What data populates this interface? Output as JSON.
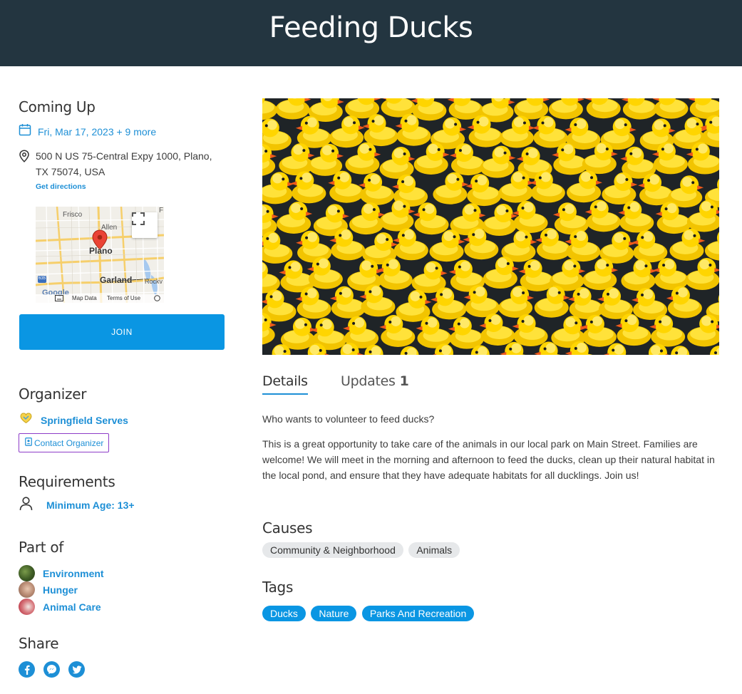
{
  "header": {
    "title": "Feeding Ducks"
  },
  "coming_up": {
    "title": "Coming Up",
    "date_text": "Fri, Mar 17, 2023 + 9 more",
    "address": "500 N US 75-Central Expy 1000, Plano, TX 75074, USA",
    "directions_label": "Get directions"
  },
  "map": {
    "labels": {
      "frisco": "Frisco",
      "allen": "Allen",
      "plano": "Plano",
      "garland": "Garland",
      "rockwall": "Rockv",
      "interstate": "635",
      "f_edge": "F"
    },
    "logo": "Google",
    "footer": {
      "map_data": "Map Data",
      "terms": "Terms of Use"
    }
  },
  "join_label": "JOIN",
  "organizer": {
    "title": "Organizer",
    "name": "Springfield Serves",
    "contact_label": "Contact Organizer"
  },
  "requirements": {
    "title": "Requirements",
    "min_age": "Minimum Age: 13+"
  },
  "part_of": {
    "title": "Part of",
    "items": [
      {
        "label": "Environment"
      },
      {
        "label": "Hunger"
      },
      {
        "label": "Animal Care"
      }
    ]
  },
  "share": {
    "title": "Share",
    "icons": [
      "facebook-icon",
      "messenger-icon",
      "twitter-icon"
    ]
  },
  "tabs": {
    "details": "Details",
    "updates": "Updates",
    "updates_count": "1"
  },
  "details": {
    "intro": "Who wants to volunteer to feed ducks?",
    "body": "This is a great opportunity to take care of the animals in our local park on Main Street. Families are welcome! We will meet in the morning and afternoon to feed the ducks, clean up their natural habitat in the local pond, and ensure that they have adequate habitats for all ducklings. Join us!"
  },
  "causes": {
    "title": "Causes",
    "items": [
      "Community & Neighborhood",
      "Animals"
    ]
  },
  "tags": {
    "title": "Tags",
    "items": [
      "Ducks",
      "Nature",
      "Parks And Recreation"
    ]
  },
  "colors": {
    "header_bg": "#233540",
    "accent": "#1d8fd6",
    "button": "#0a96e3",
    "contact_border": "#8d3cc8"
  }
}
